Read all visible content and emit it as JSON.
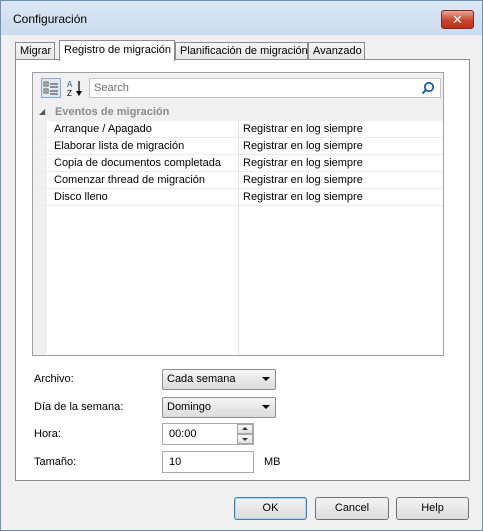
{
  "window": {
    "title": "Configuración",
    "close_label": "✕"
  },
  "tabs": [
    {
      "label": "Migrar"
    },
    {
      "label": "Registro de migración"
    },
    {
      "label": "Planificación de migración"
    },
    {
      "label": "Avanzado"
    }
  ],
  "grid": {
    "search_placeholder": "Search",
    "category": {
      "arrow": "◢",
      "label": "Eventos de migración"
    },
    "rows": [
      {
        "name": "Arranque / Apagado",
        "value": "Registrar en log siempre"
      },
      {
        "name": "Elaborar lista de migración",
        "value": "Registrar en log siempre"
      },
      {
        "name": "Copia de documentos completada",
        "value": "Registrar en log siempre"
      },
      {
        "name": "Comenzar thread de migración",
        "value": "Registrar en log siempre"
      },
      {
        "name": "Disco lleno",
        "value": "Registrar en log siempre"
      }
    ]
  },
  "form": {
    "archivo_label": "Archivo:",
    "archivo_value": "Cada semana",
    "dia_label": "Día de la semana:",
    "dia_value": "Domingo",
    "hora_label": "Hora:",
    "hora_value": "00:00",
    "tamano_label": "Tamaño:",
    "tamano_value": "10",
    "tamano_unit": "MB"
  },
  "buttons": {
    "ok": "OK",
    "cancel": "Cancel",
    "help": "Help"
  },
  "colors": {
    "search_icon": "#1f5fa8",
    "accent_border": "#3c7fb1"
  }
}
